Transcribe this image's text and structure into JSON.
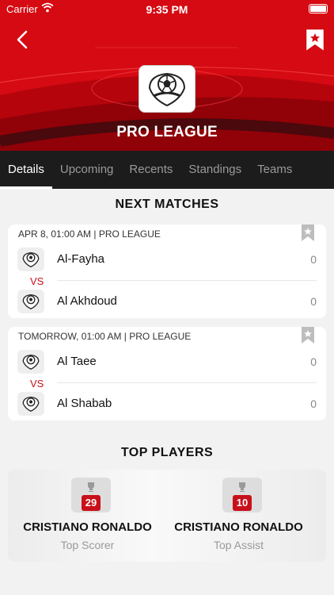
{
  "status_bar": {
    "carrier": "Carrier",
    "time": "9:35 PM"
  },
  "header": {
    "league_title": "PRO LEAGUE",
    "icons": {
      "back": "back-chevron-icon",
      "bookmark": "bookmark-star-icon",
      "logo": "soccer-ball-shield-icon"
    }
  },
  "tabs": [
    {
      "label": "Details",
      "active": true
    },
    {
      "label": "Upcoming",
      "active": false
    },
    {
      "label": "Recents",
      "active": false
    },
    {
      "label": "Standings",
      "active": false
    },
    {
      "label": "Teams",
      "active": false
    }
  ],
  "next_matches": {
    "title": "NEXT MATCHES",
    "vs_label": "VS",
    "matches": [
      {
        "meta": "APR 8, 01:00 AM | PRO LEAGUE",
        "home": {
          "name": "Al-Fayha",
          "score": "0"
        },
        "away": {
          "name": "Al Akhdoud",
          "score": "0"
        }
      },
      {
        "meta": "TOMORROW, 01:00 AM | PRO LEAGUE",
        "home": {
          "name": "Al Taee",
          "score": "0"
        },
        "away": {
          "name": "Al Shabab",
          "score": "0"
        }
      }
    ]
  },
  "top_players": {
    "title": "TOP PLAYERS",
    "players": [
      {
        "name": "CRISTIANO RONALDO",
        "number": "29",
        "role": "Top Scorer"
      },
      {
        "name": "CRISTIANO RONALDO",
        "number": "10",
        "role": "Top Assist"
      }
    ]
  },
  "colors": {
    "accent": "#d50a12",
    "tab_bar": "#1c1c1c"
  }
}
